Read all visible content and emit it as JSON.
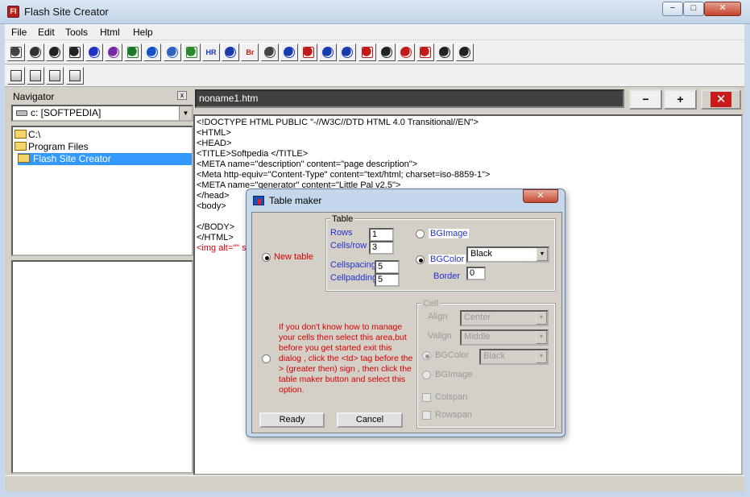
{
  "window": {
    "title": "Flash Site Creator",
    "icon_text": "FI",
    "min": "−",
    "max": "□",
    "close": "✕"
  },
  "menu": [
    "File",
    "Edit",
    "Tools",
    "Html",
    "Help"
  ],
  "toolbar1_icons": [
    {
      "name": "new-page-icon",
      "color": "#444"
    },
    {
      "name": "print-icon",
      "color": "#333"
    },
    {
      "name": "open-icon",
      "color": "#222"
    },
    {
      "name": "save-icon",
      "color": "#222"
    },
    {
      "name": "back-arrow-icon",
      "color": "#2030c0"
    },
    {
      "name": "forward-arrow-icon",
      "color": "#7a2aa0"
    },
    {
      "name": "globe-icon",
      "color": "#1a7a2a"
    },
    {
      "name": "add-icon",
      "color": "#1450c8"
    },
    {
      "name": "tree-icon",
      "color": "#3060c0"
    },
    {
      "name": "image-icon",
      "color": "#2a8a2a"
    },
    {
      "name": "hr-icon",
      "color": "#1a3ab0",
      "text": "HR"
    },
    {
      "name": "frame-icon",
      "color": "#1a3ab0"
    },
    {
      "name": "br-icon",
      "color": "#c01a1a",
      "text": "Br"
    },
    {
      "name": "link-icon",
      "color": "#444"
    },
    {
      "name": "table-icon",
      "color": "#1a3ab0"
    },
    {
      "name": "flash-icon",
      "color": "#c01a1a"
    },
    {
      "name": "table-maker-icon",
      "color": "#1a3ab0"
    },
    {
      "name": "paragraph-icon",
      "color": "#1a3ab0"
    },
    {
      "name": "sound-icon",
      "color": "#c01a1a"
    },
    {
      "name": "columns-icon",
      "color": "#222"
    },
    {
      "name": "delete-icon",
      "color": "#c01a1a"
    },
    {
      "name": "check-icon",
      "color": "#c01a1a"
    },
    {
      "name": "step-icon",
      "color": "#222"
    },
    {
      "name": "text-icon",
      "color": "#222"
    }
  ],
  "toolbar2_icons": [
    {
      "name": "copy-icon"
    },
    {
      "name": "cut-icon"
    },
    {
      "name": "paste-icon"
    },
    {
      "name": "preview-icon"
    }
  ],
  "navigator": {
    "title": "Navigator",
    "close": "x",
    "drive": "c: [SOFTPEDIA]",
    "tree": [
      {
        "label": "C:\\",
        "indent": 0,
        "selected": false
      },
      {
        "label": "Program Files",
        "indent": 0,
        "selected": false
      },
      {
        "label": "Flash Site Creator",
        "indent": 1,
        "selected": true
      }
    ]
  },
  "document": {
    "tab": "noname1.htm",
    "btn_minus": "−",
    "btn_plus": "+",
    "btn_close": "✕",
    "code": [
      {
        "text": "<!DOCTYPE HTML PUBLIC \"-//W3C//DTD HTML 4.0 Transitional//EN\">",
        "red": false
      },
      {
        "text": "<HTML>",
        "red": false
      },
      {
        "text": "<HEAD>",
        "red": false
      },
      {
        "text": "<TITLE>Softpedia </TITLE>",
        "red": false
      },
      {
        "text": "<META name=\"description\" content=\"page description\">",
        "red": false
      },
      {
        "text": "<Meta http-equiv=\"Content-Type\" content=\"text/html; charset=iso-8859-1\">",
        "red": false
      },
      {
        "text": "<META name=\"generator\" content=\"Little Pal v2.5\">",
        "red": false
      },
      {
        "text": "</head>",
        "red": false
      },
      {
        "text": "<body>",
        "red": false
      },
      {
        "text": "",
        "red": false
      },
      {
        "text": "</BODY>",
        "red": false
      },
      {
        "text": "</HTML>",
        "red": false
      },
      {
        "text": "<img alt=\"\" sr",
        "red": true
      }
    ]
  },
  "dialog": {
    "title": "Table maker",
    "close": "✕",
    "new_table_label": "New table",
    "table_group": "Table",
    "rows_label": "Rows",
    "rows_value": "1",
    "cells_label": "Cells/row",
    "cells_value": "3",
    "cellspacing_label": "Cellspacing",
    "cellspacing_value": "5",
    "cellpadding_label": "Cellpadding",
    "cellpadding_value": "5",
    "bgimage_label": "BGImage",
    "bgcolor_label": "BGColor",
    "bgcolor_value": "Black",
    "border_label": "Border",
    "border_value": "0",
    "info_text": "If you don't know how to manage your cells then select this area,but before you get started exit this dialog , click the <td> tag before the > (greater then) sign , then click the table maker button and select this option.",
    "cell_group": "Cell",
    "align_label": "Align",
    "align_value": "Center",
    "valign_label": "Valign",
    "valign_value": "Middle",
    "cell_bgcolor_label": "BGColor",
    "cell_bgcolor_value": "Black",
    "cell_bgimage_label": "BGImage",
    "colspan_label": "Colspan",
    "rowspan_label": "Rowspan",
    "ready_label": "Ready",
    "cancel_label": "Cancel"
  }
}
